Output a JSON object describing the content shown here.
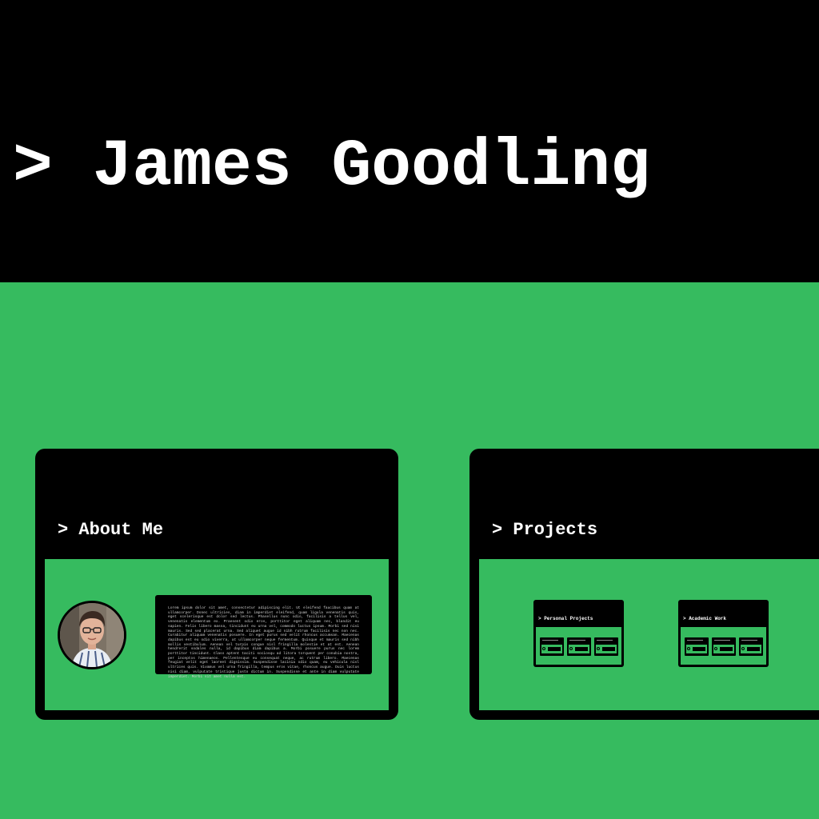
{
  "header": {
    "title": "> James Goodling"
  },
  "about": {
    "heading": "> About Me",
    "bio": "Lorem ipsum dolor sit amet, consectetur adipiscing elit. Ut eleifend faucibus quam at ullamcorper. Donec ultricies, diam in imperdiet eleifend, quam ligula venenatis quis, eget scelerisque est dolor sed lectus. Phasellus nunc odio, facilisis a tellus vel, venenatis elementum ex. Praesent odio eros, porttitor eget aliquam nec, blandit eu sapien. Felis libero massa, tincidunt eu urna vel, commodo luctus ipsum. Morbi sed nisi mauris. Sed sed placerat urna. Sed aliquet augue id nibh rutrum facilisis nec non nec. Curabitur aliquam venenatis posuere. In eget purus sed velit rhoncus accumsan. Maecenas dapibus est eu odio viverra, at ullamcorper neque fermentum. Quisque et mauris sed nibh mollis vestibulum. Aenean vel turpis congue nisl fringilla molestie et at est. Aenean hendrerit sodales nulla, id dapibus diam dapibus a. Morbi posuere purus nec lorem porttitor tincidunt. Class aptent taciti sociosqu ad litora torquent per conubia nostra, per inceptos himenaeos. Pellentesque eu consequat neque, ac rutrum libero. Maecenas feugiat velit eget laoreet dignissim. Suspendisse lacinia odio quam, eu vehicula nisl ultrices quis. Vivamus vel urna fringilla, tempus eros vitae, rhoncus augue. Duis luctus nisi diam, vulputate tristique justo dictum in. Suspendisse et ante in diam vulputate imperdiet. Morbi sit amet nulla est."
  },
  "projects": {
    "heading": "> Projects",
    "groups": [
      {
        "title": "> Personal Projects"
      },
      {
        "title": "> Academic Work"
      }
    ]
  },
  "colors": {
    "background": "#36bb5f",
    "panel": "#000000",
    "text": "#ffffff"
  }
}
